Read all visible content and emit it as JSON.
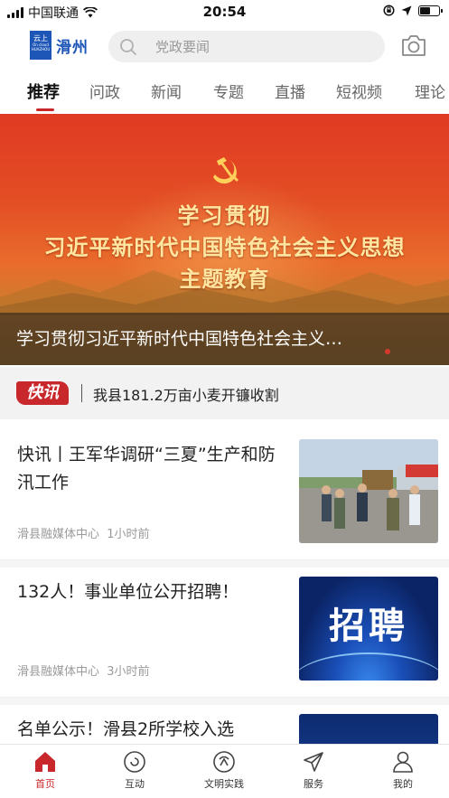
{
  "status_bar": {
    "carrier": "中国联通",
    "time": "20:54"
  },
  "header": {
    "logo_small": "云上",
    "logo_tiny": "On cloud HUAZHOU",
    "app_name": "滑州",
    "search_placeholder": "党政要闻"
  },
  "tabs": [
    {
      "label": "推荐",
      "active": true
    },
    {
      "label": "问政"
    },
    {
      "label": "新闻"
    },
    {
      "label": "专题"
    },
    {
      "label": "直播"
    },
    {
      "label": "短视频"
    },
    {
      "label": "理论"
    }
  ],
  "banner": {
    "line1": "学习贯彻",
    "line2": "习近平新时代中国特色社会主义思想",
    "line3": "主题教育",
    "caption": "学习贯彻习近平新时代中国特色社会主义…"
  },
  "flash": {
    "badge": "快讯",
    "text": "我县181.2万亩小麦开镰收割"
  },
  "articles": [
    {
      "title": "快讯丨王军华调研“三夏”生产和防汛工作",
      "source": "滑县融媒体中心",
      "time": "1小时前",
      "thumb_icon": "field-inspection-photo"
    },
    {
      "title": "132人！事业单位公开招聘！",
      "source": "滑县融媒体中心",
      "time": "3小时前",
      "thumb_text": "招聘",
      "thumb_icon": "recruitment-banner"
    },
    {
      "title": "名单公示！滑县2所学校入选",
      "thumb_icon": "announcement-banner"
    }
  ],
  "bottom_nav": [
    {
      "label": "首页",
      "icon": "home-icon",
      "active": true
    },
    {
      "label": "互动",
      "icon": "interact-icon"
    },
    {
      "label": "文明实践",
      "icon": "civilization-icon"
    },
    {
      "label": "服务",
      "icon": "send-icon"
    },
    {
      "label": "我的",
      "icon": "user-icon"
    }
  ],
  "colors": {
    "accent": "#c8272b",
    "brand": "#1d56b6"
  }
}
